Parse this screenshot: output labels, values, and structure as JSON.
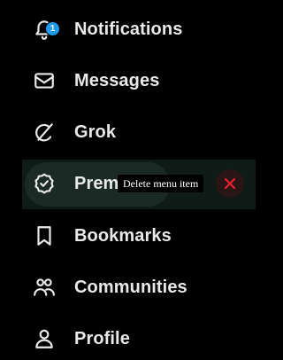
{
  "nav": {
    "items": [
      {
        "label": "Notifications",
        "icon": "bell-icon",
        "badge": "1"
      },
      {
        "label": "Messages",
        "icon": "envelope-icon"
      },
      {
        "label": "Grok",
        "icon": "grok-icon"
      },
      {
        "label": "Premi",
        "icon": "verified-badge-icon"
      },
      {
        "label": "Bookmarks",
        "icon": "bookmark-icon"
      },
      {
        "label": "Communities",
        "icon": "communities-icon"
      },
      {
        "label": "Profile",
        "icon": "person-icon"
      }
    ]
  },
  "edit": {
    "tooltip": "Delete menu item",
    "delete_icon": "close-icon"
  },
  "colors": {
    "background": "#000000",
    "text": "#e7e9ea",
    "badge": "#1d9bf0",
    "delete": "#f4212e",
    "edit_row": "#0f1b17"
  }
}
